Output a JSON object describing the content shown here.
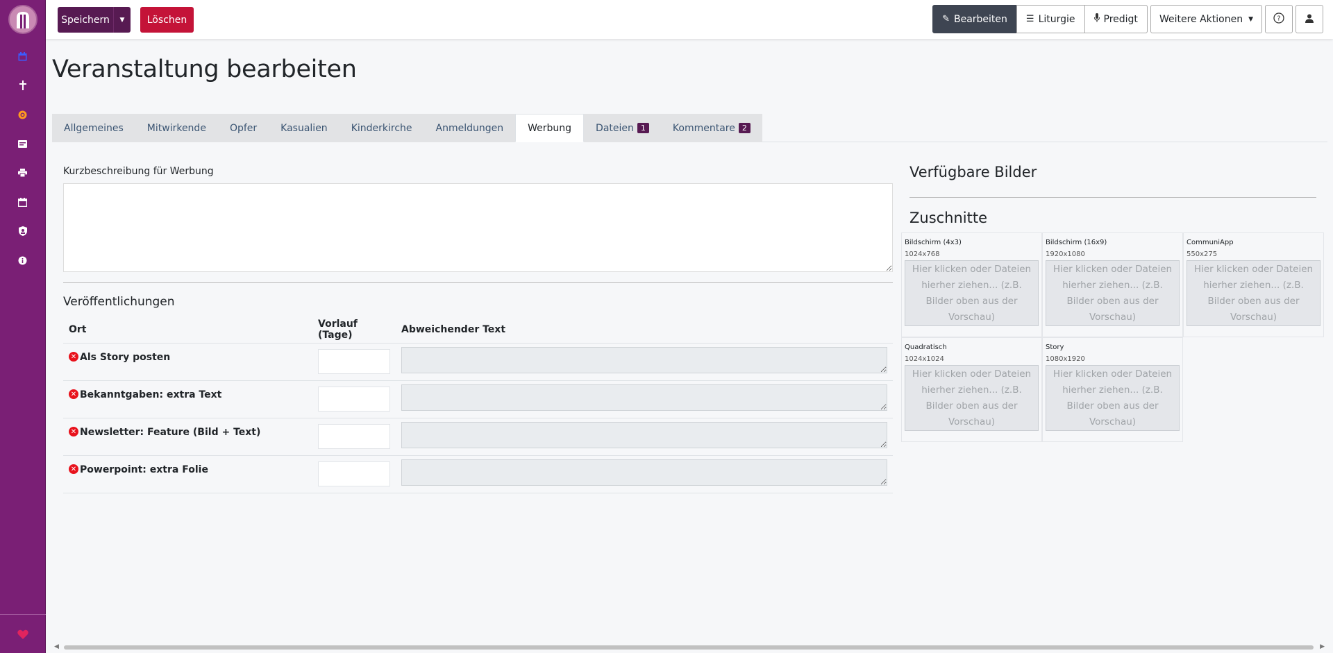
{
  "sidebar": {
    "items": [
      {
        "icon": "calendar-icon"
      },
      {
        "icon": "cross-icon"
      },
      {
        "icon": "globe-icon"
      },
      {
        "icon": "card-icon"
      },
      {
        "icon": "printer-icon"
      },
      {
        "icon": "calendar-grid-icon"
      },
      {
        "icon": "shield-user-icon"
      },
      {
        "icon": "info-icon"
      }
    ],
    "bottom_icon": "heart-icon"
  },
  "toolbar": {
    "save_label": "Speichern",
    "delete_label": "Löschen",
    "edit_label": "Bearbeiten",
    "liturgy_label": "Liturgie",
    "sermon_label": "Predigt",
    "more_label": "Weitere Aktionen"
  },
  "page": {
    "title": "Veranstaltung bearbeiten"
  },
  "tabs": [
    {
      "label": "Allgemeines"
    },
    {
      "label": "Mitwirkende"
    },
    {
      "label": "Opfer"
    },
    {
      "label": "Kasualien"
    },
    {
      "label": "Kinderkirche"
    },
    {
      "label": "Anmeldungen"
    },
    {
      "label": "Werbung",
      "active": true
    },
    {
      "label": "Dateien",
      "badge": "1"
    },
    {
      "label": "Kommentare",
      "badge": "2"
    }
  ],
  "advertising": {
    "short_desc_label": "Kurzbeschreibung für Werbung",
    "short_desc_value": "",
    "publications_heading": "Veröffentlichungen",
    "columns": [
      "Ort",
      "Vorlauf (Tage)",
      "Abweichender Text"
    ],
    "rows": [
      {
        "name": "Als Story posten"
      },
      {
        "name": "Bekanntgaben: extra Text"
      },
      {
        "name": "Newsletter: Feature (Bild + Text)"
      },
      {
        "name": "Powerpoint: extra Folie"
      }
    ]
  },
  "images": {
    "available_heading": "Verfügbare Bilder",
    "crops_heading": "Zuschnitte",
    "drop_text": "Hier klicken oder Dateien hierher ziehen... (z.B. Bilder oben aus der Vorschau)",
    "crops": [
      {
        "name": "Bildschirm (4x3)",
        "size": "1024x768"
      },
      {
        "name": "Bildschirm (16x9)",
        "size": "1920x1080"
      },
      {
        "name": "CommuniApp",
        "size": "550x275"
      },
      {
        "name": "Quadratisch",
        "size": "1024x1024"
      },
      {
        "name": "Story",
        "size": "1080x1920"
      }
    ]
  },
  "colors": {
    "sidebar": "#7a1f75",
    "primary": "#571a52",
    "danger": "#c41338",
    "active_button": "#3e4552"
  }
}
